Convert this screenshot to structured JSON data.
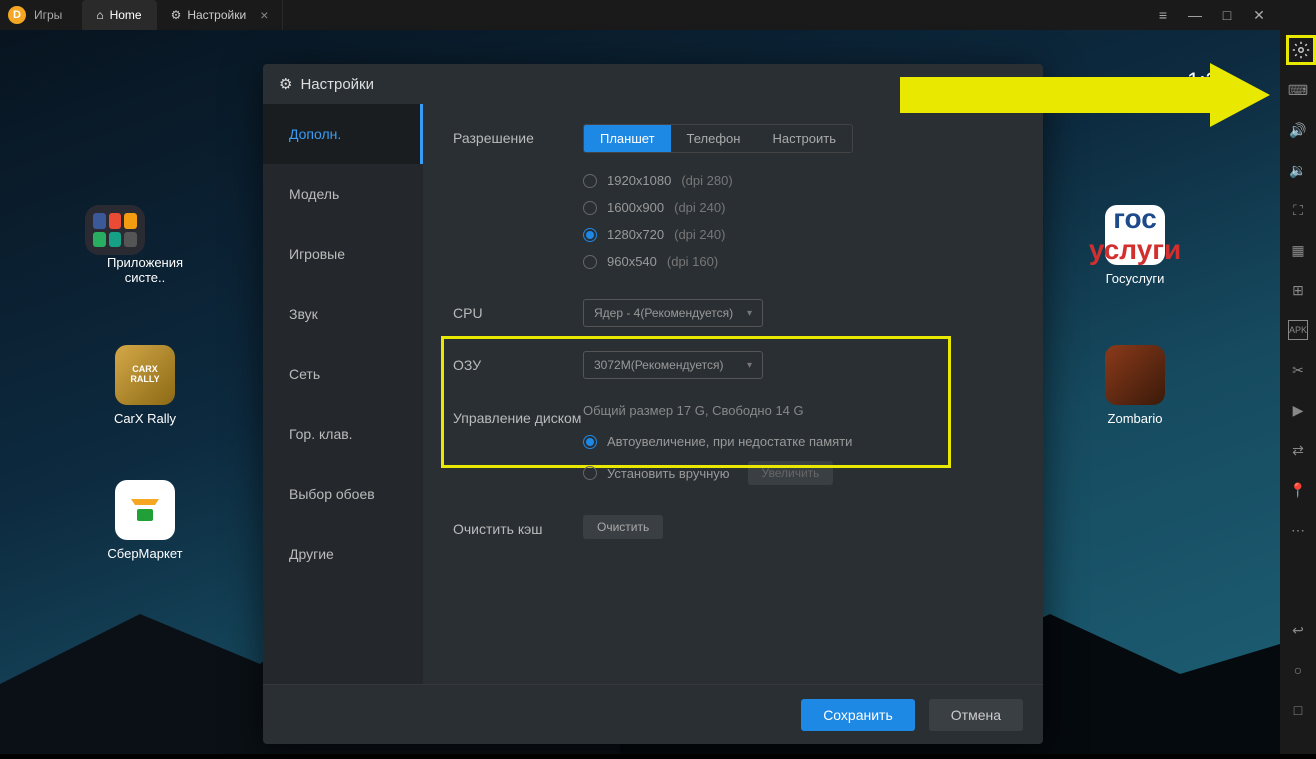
{
  "titlebar": {
    "app_title": "Игры",
    "tabs": [
      {
        "label": "Home",
        "icon": "home"
      },
      {
        "label": "Настройки",
        "icon": "gear"
      }
    ]
  },
  "clock": "1:30",
  "desktop_icons": {
    "sysapps": "Приложения систе..",
    "carx": "CarX Rally",
    "sber": "СберМаркет",
    "gos": "Госуслуги",
    "gos_line1": "гос",
    "gos_line2": "услуги",
    "zomb": "Zombario"
  },
  "settings": {
    "title": "Настройки",
    "sidebar": [
      "Дополн.",
      "Модель",
      "Игровые",
      "Звук",
      "Сеть",
      "Гор. клав.",
      "Выбор обоев",
      "Другие"
    ],
    "resolution": {
      "label": "Разрешение",
      "modes": [
        "Планшет",
        "Телефон",
        "Настроить"
      ],
      "options": [
        {
          "res": "1920x1080",
          "dpi": "(dpi 280)"
        },
        {
          "res": "1600x900",
          "dpi": "(dpi 240)"
        },
        {
          "res": "1280x720",
          "dpi": "(dpi 240)"
        },
        {
          "res": "960x540",
          "dpi": "(dpi 160)"
        }
      ]
    },
    "cpu": {
      "label": "CPU",
      "value": "Ядер - 4(Рекомендуется)"
    },
    "ram": {
      "label": "ОЗУ",
      "value": "3072M(Рекомендуется)"
    },
    "disk": {
      "label": "Управление диском",
      "info": "Общий размер 17 G,   Свободно 14 G",
      "auto": "Автоувеличение, при недостатке памяти",
      "manual": "Установить вручную",
      "enlarge": "Увеличить"
    },
    "cache": {
      "label": "Очистить кэш",
      "btn": "Очистить"
    },
    "save": "Сохранить",
    "cancel": "Отмена"
  }
}
